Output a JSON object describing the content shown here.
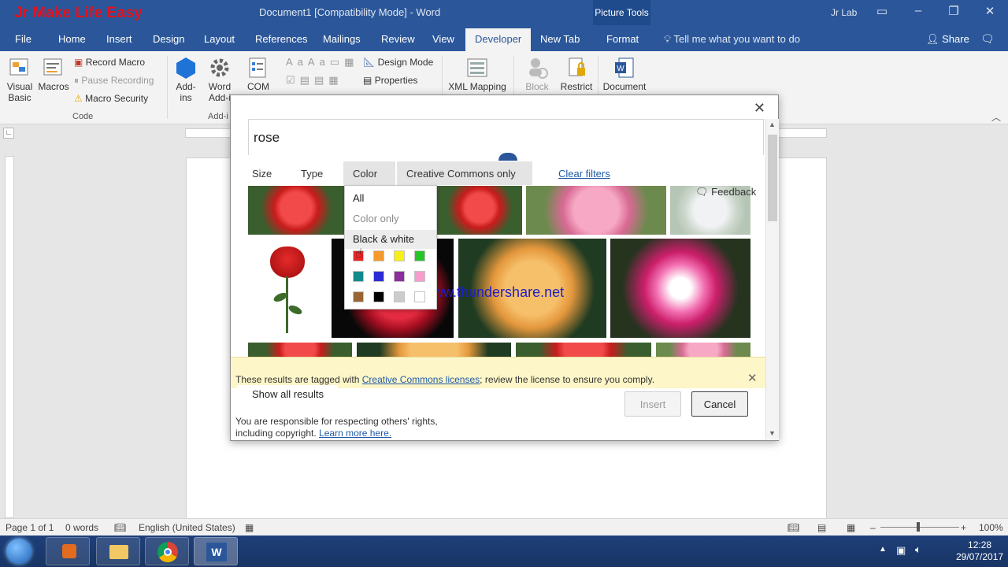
{
  "window": {
    "watermark": "Jr Make Life Easy",
    "title": "Document1 [Compatibility Mode]  -  Word",
    "context_tab": "Picture Tools",
    "user": "Jr Lab"
  },
  "tabs": [
    "File",
    "Home",
    "Insert",
    "Design",
    "Layout",
    "References",
    "Mailings",
    "Review",
    "View",
    "Developer",
    "New Tab",
    "Format"
  ],
  "active_tab": "Developer",
  "tell_me": "Tell me what you want to do",
  "share": "Share",
  "ribbon": {
    "visual_basic": "Visual\nBasic",
    "macros": "Macros",
    "record_macro": "Record Macro",
    "pause_recording": "Pause Recording",
    "macro_security": "Macro Security",
    "code_group": "Code",
    "add_ins": "Add-\nins",
    "word_add_ins": "Word\nAdd-i",
    "com": "COM",
    "add_ins_group": "Add-i",
    "design_mode": "Design Mode",
    "properties": "Properties",
    "xml_mapping": "XML Mapping",
    "block": "Block",
    "restrict": "Restrict",
    "document": "Document"
  },
  "dialog": {
    "search_value": "rose",
    "filters": [
      "Size",
      "Type",
      "Color",
      "Creative Commons only"
    ],
    "clear_filters": "Clear filters",
    "feedback": "Feedback",
    "color_menu": {
      "items": [
        "All",
        "Color only",
        "Black & white"
      ],
      "swatches": [
        "#e62626",
        "#f39a2b",
        "#f7ef16",
        "#28c22a",
        "#108a8a",
        "#2c2cd6",
        "#8c2e9c",
        "#f79ccb",
        "#996633",
        "#000000",
        "#cccccc",
        "#ffffff"
      ]
    },
    "watermark_url": "www.thundershare.net",
    "cc_notice_pre": "These results are tagged with ",
    "cc_notice_link": "Creative Commons licenses",
    "cc_notice_post": "; review the license to ensure you comply.",
    "show_all": "Show all results",
    "insert": "Insert",
    "cancel": "Cancel",
    "rights_line1": "You are responsible for respecting others' rights,",
    "rights_line2": "including copyright. ",
    "rights_link": "Learn more here."
  },
  "status": {
    "page": "Page 1 of 1",
    "words": "0 words",
    "language": "English (United States)",
    "zoom": "100%"
  },
  "taskbar": {
    "time": "12:28",
    "date": "29/07/2017"
  }
}
